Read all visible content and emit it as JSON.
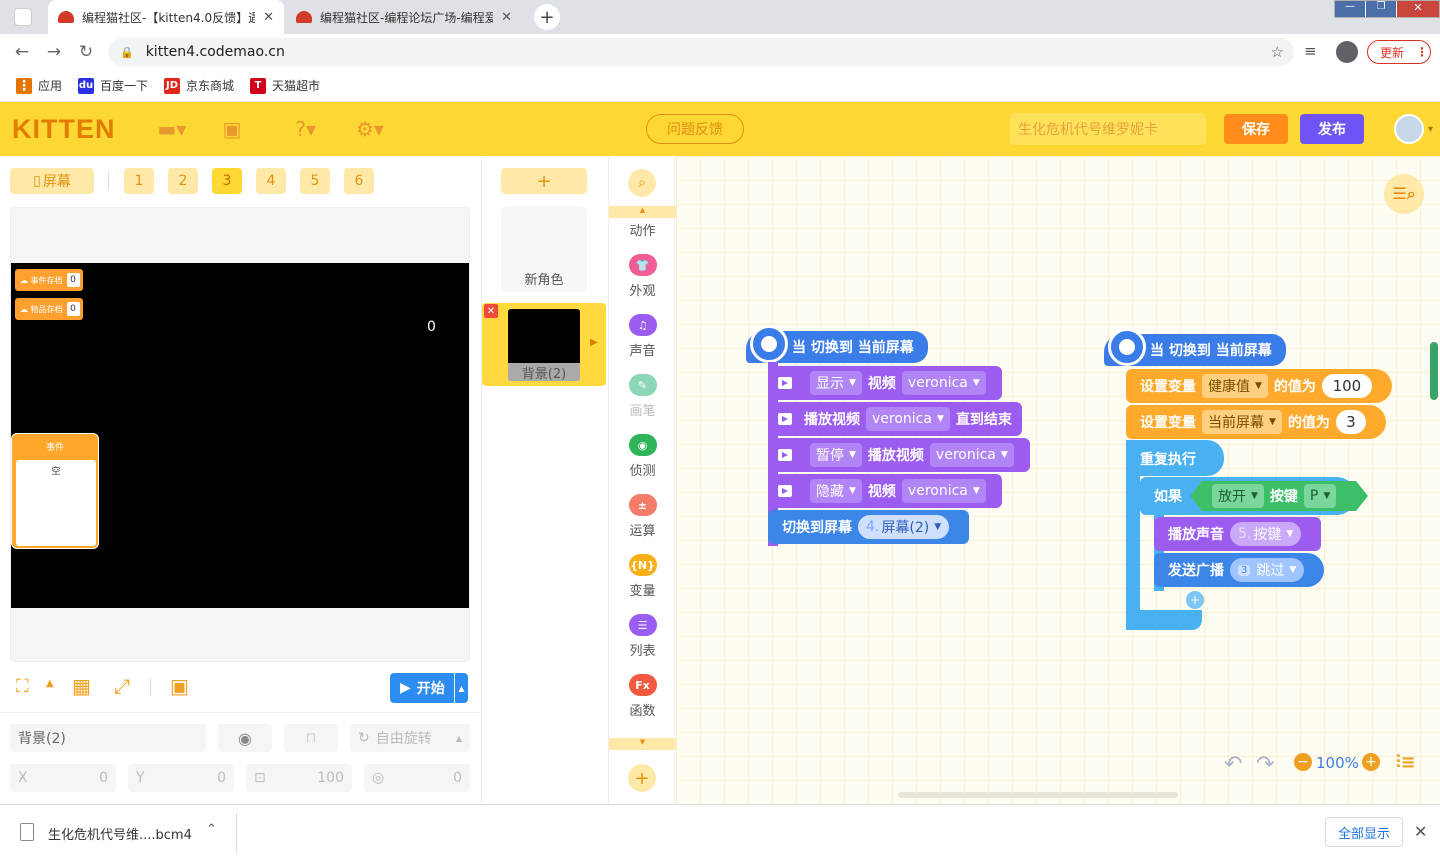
{
  "browser": {
    "tabs": [
      {
        "title": "编程猫社区-【kitten4.0反馈】遇"
      },
      {
        "title": "编程猫社区-编程论坛广场-编程爱"
      }
    ],
    "url": "kitten4.codemao.cn",
    "update_label": "更新",
    "bookmarks": [
      "应用",
      "百度一下",
      "京东商城",
      "天猫超市"
    ]
  },
  "app": {
    "logo": "KITTEN",
    "feedback_label": "问题反馈",
    "project_name": "生化危机代号维罗妮卡",
    "save_label": "保存",
    "publish_label": "发布"
  },
  "screens": {
    "screen_label": "屏幕",
    "tabs": [
      "1",
      "2",
      "3",
      "4",
      "5",
      "6"
    ],
    "active": "3"
  },
  "stage": {
    "badges": [
      {
        "label": "事件存档",
        "value": "0"
      },
      {
        "label": "物品存档",
        "value": "0"
      }
    ],
    "counter": "0",
    "event_panel": {
      "title": "事件",
      "content": "空"
    },
    "start_label": "开始"
  },
  "props": {
    "name": "背景(2)",
    "rotation_label": "自由旋转",
    "x_label": "X",
    "x_value": "0",
    "y_label": "Y",
    "y_value": "0",
    "size_value": "100",
    "rot_value": "0"
  },
  "sprites": {
    "add_label": "+",
    "new_label": "新角色",
    "items": [
      {
        "name": "背景(2)"
      }
    ]
  },
  "categories": [
    {
      "label": "动作",
      "icon": "motion-icon",
      "color": "#f5a623"
    },
    {
      "label": "外观",
      "icon": "shirt-icon",
      "color": "#f25d95"
    },
    {
      "label": "声音",
      "icon": "music-icon",
      "color": "#9b5cf0"
    },
    {
      "label": "画笔",
      "icon": "pen-icon",
      "color": "#8ed6b8"
    },
    {
      "label": "侦测",
      "icon": "sensing-icon",
      "color": "#2fb45a"
    },
    {
      "label": "运算",
      "icon": "operator-icon",
      "color": "#f47d6a"
    },
    {
      "label": "变量",
      "icon": "variable-icon",
      "color": "#f7b016"
    },
    {
      "label": "列表",
      "icon": "list-icon",
      "color": "#9b5cf0"
    },
    {
      "label": "函数",
      "icon": "function-icon",
      "color": "#f25a40"
    }
  ],
  "scripts": {
    "s1": {
      "hat": "当 切换到 当前屏幕",
      "rows": [
        {
          "a": "显示",
          "b": "视频",
          "c": "veronica"
        },
        {
          "a": "播放视频",
          "b": "veronica",
          "c": "直到结束"
        },
        {
          "a": "暂停",
          "b": "播放视频",
          "c": "veronica"
        },
        {
          "a": "隐藏",
          "b": "视频",
          "c": "veronica"
        }
      ],
      "switch": {
        "label": "切换到屏幕",
        "num": "4.",
        "value": "屏幕(2)"
      }
    },
    "s2": {
      "hat": "当 切换到 当前屏幕",
      "set1": {
        "label": "设置变量",
        "var": "健康值",
        "op": "的值为",
        "value": "100"
      },
      "set2": {
        "label": "设置变量",
        "var": "当前屏幕",
        "op": "的值为",
        "value": "3"
      },
      "repeat": "重复执行",
      "if_label": "如果",
      "cond": {
        "a": "放开",
        "b": "按键",
        "c": "P"
      },
      "sound": {
        "label": "播放声音",
        "num": "5.",
        "value": "按键"
      },
      "broadcast": {
        "label": "发送广播",
        "num": "3",
        "value": "跳过"
      }
    }
  },
  "zoom": "100%",
  "download": {
    "file": "生化危机代号维....bcm4",
    "show_all": "全部显示"
  }
}
